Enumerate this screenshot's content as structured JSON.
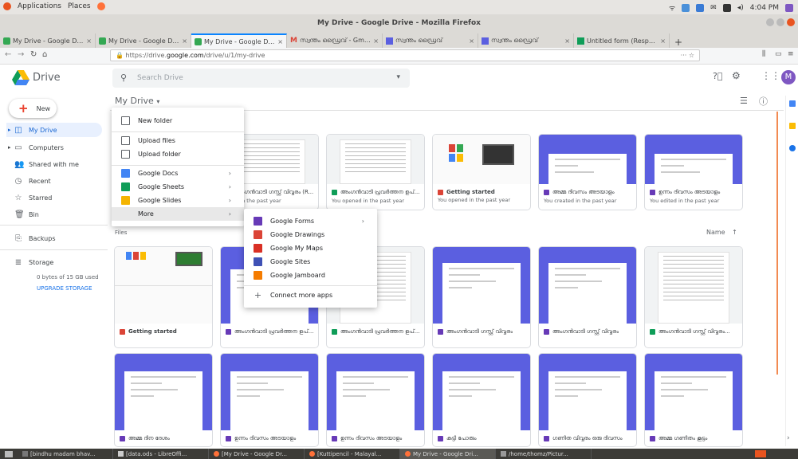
{
  "system": {
    "applications": "Applications",
    "places": "Places",
    "time": "4:04 PM",
    "user_initial": "M"
  },
  "window_title": "My Drive - Google Drive - Mozilla Firefox",
  "tabs": [
    {
      "label": "My Drive - Google Drive"
    },
    {
      "label": "My Drive - Google Drive"
    },
    {
      "label": "My Drive - Google Drive"
    },
    {
      "label": "സ്വന്തം ഡ്രൈവ് - Gmail"
    },
    {
      "label": "സ്വന്തം ഡ്രൈവ്"
    },
    {
      "label": "സ്വന്തം ഡ്രൈവ്"
    },
    {
      "label": "Untitled form (Respon..."
    }
  ],
  "url": {
    "prefix": "https://drive.",
    "host": "google.com",
    "path": "/drive/u/1/my-drive"
  },
  "drive": {
    "app_name": "Drive",
    "search_placeholder": "Search Drive",
    "avatar": "M"
  },
  "sidebar": {
    "new_label": "New",
    "items": [
      {
        "label": "My Drive"
      },
      {
        "label": "Computers"
      },
      {
        "label": "Shared with me"
      },
      {
        "label": "Recent"
      },
      {
        "label": "Starred"
      },
      {
        "label": "Bin"
      },
      {
        "label": "Backups"
      },
      {
        "label": "Storage"
      }
    ],
    "storage_text": "0 bytes of 15 GB used",
    "upgrade": "UPGRADE STORAGE"
  },
  "toolbar": {
    "breadcrumb": "My Drive",
    "files_heading": "Files",
    "sort_label": "Name"
  },
  "new_menu": {
    "items": [
      {
        "label": "New folder"
      },
      {
        "label": "Upload files"
      },
      {
        "label": "Upload folder"
      },
      {
        "label": "Google Docs"
      },
      {
        "label": "Google Sheets"
      },
      {
        "label": "Google Slides"
      },
      {
        "label": "More"
      }
    ]
  },
  "more_menu": {
    "items": [
      {
        "label": "Google Forms"
      },
      {
        "label": "Google Drawings"
      },
      {
        "label": "Google My Maps"
      },
      {
        "label": "Google Sites"
      },
      {
        "label": "Google Jamboard"
      },
      {
        "label": "Connect more apps"
      }
    ]
  },
  "quick_access": [
    {
      "name": "അംഗൻവാടി ഗസ്റ്റ് വിവ്വരം (R...",
      "sub": "ened in the past year",
      "icon": "docs"
    },
    {
      "name": "അംഗൻവാടി പ്രവർത്തന ഉപ്...",
      "sub": "You opened in the past year",
      "icon": "sheets"
    },
    {
      "name": "Getting started",
      "sub": "You opened in the past year",
      "icon": "pdf"
    },
    {
      "name": "അമ്മ ദിവസം അടയാളം",
      "sub": "You created in the past year",
      "icon": "forms"
    },
    {
      "name": "ഉന്നം ദിവസം അടയാളം",
      "sub": "You edited in the past year",
      "icon": "forms"
    }
  ],
  "files_row1": [
    {
      "name": "Getting started",
      "icon": "pdf"
    },
    {
      "name": "അംഗൻവാടി പ്രവർത്തന ഉപ്...",
      "icon": "forms"
    },
    {
      "name": "അംഗൻവാടി പ്രവർത്തന ഉപ്...",
      "icon": "sheets"
    },
    {
      "name": "അംഗൻവാടി ഗസ്റ്റ് വിവ്വരം",
      "icon": "forms"
    },
    {
      "name": "അംഗൻവാടി ഗസ്റ്റ് വിവ്വരം",
      "icon": "forms"
    },
    {
      "name": "അംഗൻവാടി ഗസ്റ്റ് വിവ്വരം...",
      "icon": "sheets"
    }
  ],
  "files_row2": [
    {
      "name": "അമ്മ ദിന ദേശം",
      "icon": "forms"
    },
    {
      "name": "ഉന്നം ദിവസം അടയാളം",
      "icon": "forms"
    },
    {
      "name": "ഉന്നം ദിവസം അടയാളം",
      "icon": "forms"
    },
    {
      "name": "കുട്ടി പോരും",
      "icon": "forms"
    },
    {
      "name": "ഗണിത വിവ്വരം ഒരു ദിവസം",
      "icon": "forms"
    },
    {
      "name": "അമ്മ ഗണിതം കൂട്ടം",
      "icon": "forms"
    }
  ],
  "taskbar": [
    {
      "label": "[bindhu madam bhav..."
    },
    {
      "label": "[data.ods - LibreOffi..."
    },
    {
      "label": "[My Drive - Google Dr..."
    },
    {
      "label": "[Kuttipencil - Malayal..."
    },
    {
      "label": "My Drive - Google Dri..."
    },
    {
      "label": "/home/thomz/Pictur..."
    }
  ],
  "colors": {
    "blue": "#4285f4",
    "green": "#0f9d58",
    "yellow": "#f4b400",
    "red": "#db4437",
    "purple": "#5b5fe0",
    "accent": "#1a73e8"
  }
}
